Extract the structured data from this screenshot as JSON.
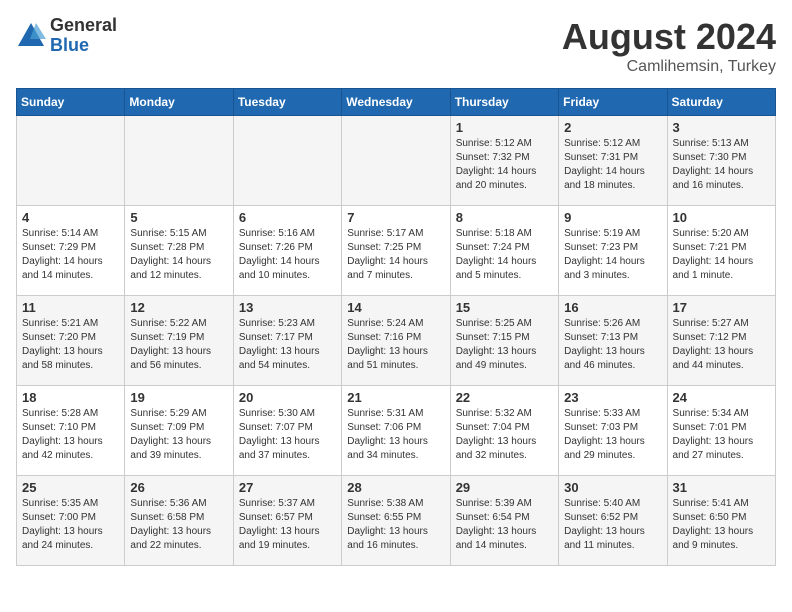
{
  "header": {
    "logo_general": "General",
    "logo_blue": "Blue",
    "month_year": "August 2024",
    "location": "Camlihemsin, Turkey"
  },
  "days_of_week": [
    "Sunday",
    "Monday",
    "Tuesday",
    "Wednesday",
    "Thursday",
    "Friday",
    "Saturday"
  ],
  "weeks": [
    [
      {
        "day": "",
        "info": ""
      },
      {
        "day": "",
        "info": ""
      },
      {
        "day": "",
        "info": ""
      },
      {
        "day": "",
        "info": ""
      },
      {
        "day": "1",
        "info": "Sunrise: 5:12 AM\nSunset: 7:32 PM\nDaylight: 14 hours\nand 20 minutes."
      },
      {
        "day": "2",
        "info": "Sunrise: 5:12 AM\nSunset: 7:31 PM\nDaylight: 14 hours\nand 18 minutes."
      },
      {
        "day": "3",
        "info": "Sunrise: 5:13 AM\nSunset: 7:30 PM\nDaylight: 14 hours\nand 16 minutes."
      }
    ],
    [
      {
        "day": "4",
        "info": "Sunrise: 5:14 AM\nSunset: 7:29 PM\nDaylight: 14 hours\nand 14 minutes."
      },
      {
        "day": "5",
        "info": "Sunrise: 5:15 AM\nSunset: 7:28 PM\nDaylight: 14 hours\nand 12 minutes."
      },
      {
        "day": "6",
        "info": "Sunrise: 5:16 AM\nSunset: 7:26 PM\nDaylight: 14 hours\nand 10 minutes."
      },
      {
        "day": "7",
        "info": "Sunrise: 5:17 AM\nSunset: 7:25 PM\nDaylight: 14 hours\nand 7 minutes."
      },
      {
        "day": "8",
        "info": "Sunrise: 5:18 AM\nSunset: 7:24 PM\nDaylight: 14 hours\nand 5 minutes."
      },
      {
        "day": "9",
        "info": "Sunrise: 5:19 AM\nSunset: 7:23 PM\nDaylight: 14 hours\nand 3 minutes."
      },
      {
        "day": "10",
        "info": "Sunrise: 5:20 AM\nSunset: 7:21 PM\nDaylight: 14 hours\nand 1 minute."
      }
    ],
    [
      {
        "day": "11",
        "info": "Sunrise: 5:21 AM\nSunset: 7:20 PM\nDaylight: 13 hours\nand 58 minutes."
      },
      {
        "day": "12",
        "info": "Sunrise: 5:22 AM\nSunset: 7:19 PM\nDaylight: 13 hours\nand 56 minutes."
      },
      {
        "day": "13",
        "info": "Sunrise: 5:23 AM\nSunset: 7:17 PM\nDaylight: 13 hours\nand 54 minutes."
      },
      {
        "day": "14",
        "info": "Sunrise: 5:24 AM\nSunset: 7:16 PM\nDaylight: 13 hours\nand 51 minutes."
      },
      {
        "day": "15",
        "info": "Sunrise: 5:25 AM\nSunset: 7:15 PM\nDaylight: 13 hours\nand 49 minutes."
      },
      {
        "day": "16",
        "info": "Sunrise: 5:26 AM\nSunset: 7:13 PM\nDaylight: 13 hours\nand 46 minutes."
      },
      {
        "day": "17",
        "info": "Sunrise: 5:27 AM\nSunset: 7:12 PM\nDaylight: 13 hours\nand 44 minutes."
      }
    ],
    [
      {
        "day": "18",
        "info": "Sunrise: 5:28 AM\nSunset: 7:10 PM\nDaylight: 13 hours\nand 42 minutes."
      },
      {
        "day": "19",
        "info": "Sunrise: 5:29 AM\nSunset: 7:09 PM\nDaylight: 13 hours\nand 39 minutes."
      },
      {
        "day": "20",
        "info": "Sunrise: 5:30 AM\nSunset: 7:07 PM\nDaylight: 13 hours\nand 37 minutes."
      },
      {
        "day": "21",
        "info": "Sunrise: 5:31 AM\nSunset: 7:06 PM\nDaylight: 13 hours\nand 34 minutes."
      },
      {
        "day": "22",
        "info": "Sunrise: 5:32 AM\nSunset: 7:04 PM\nDaylight: 13 hours\nand 32 minutes."
      },
      {
        "day": "23",
        "info": "Sunrise: 5:33 AM\nSunset: 7:03 PM\nDaylight: 13 hours\nand 29 minutes."
      },
      {
        "day": "24",
        "info": "Sunrise: 5:34 AM\nSunset: 7:01 PM\nDaylight: 13 hours\nand 27 minutes."
      }
    ],
    [
      {
        "day": "25",
        "info": "Sunrise: 5:35 AM\nSunset: 7:00 PM\nDaylight: 13 hours\nand 24 minutes."
      },
      {
        "day": "26",
        "info": "Sunrise: 5:36 AM\nSunset: 6:58 PM\nDaylight: 13 hours\nand 22 minutes."
      },
      {
        "day": "27",
        "info": "Sunrise: 5:37 AM\nSunset: 6:57 PM\nDaylight: 13 hours\nand 19 minutes."
      },
      {
        "day": "28",
        "info": "Sunrise: 5:38 AM\nSunset: 6:55 PM\nDaylight: 13 hours\nand 16 minutes."
      },
      {
        "day": "29",
        "info": "Sunrise: 5:39 AM\nSunset: 6:54 PM\nDaylight: 13 hours\nand 14 minutes."
      },
      {
        "day": "30",
        "info": "Sunrise: 5:40 AM\nSunset: 6:52 PM\nDaylight: 13 hours\nand 11 minutes."
      },
      {
        "day": "31",
        "info": "Sunrise: 5:41 AM\nSunset: 6:50 PM\nDaylight: 13 hours\nand 9 minutes."
      }
    ]
  ]
}
